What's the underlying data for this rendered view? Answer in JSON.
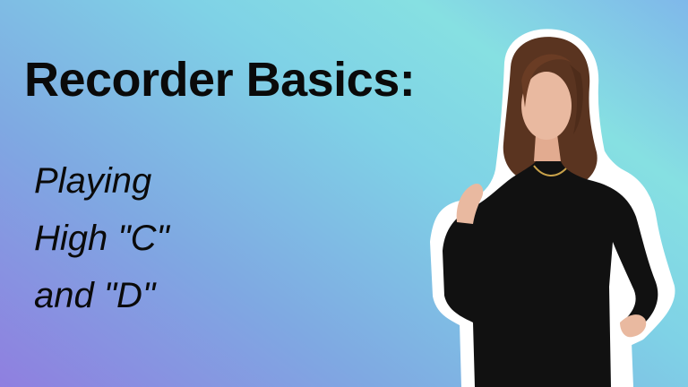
{
  "thumbnail": {
    "title": "Recorder Basics:",
    "subtitle_lines": [
      "Playing",
      "High \"C\"",
      "and \"D\""
    ],
    "colors": {
      "gradient": [
        "#8f7fe0",
        "#7fa8e2",
        "#7fd2e6",
        "#86e0e2",
        "#7fb8ea"
      ],
      "text": "#0a0a0a",
      "outfit": "#111111",
      "hair": "#5a3420",
      "skin": "#e9b9a0"
    },
    "image": "person-photo-cutout"
  }
}
